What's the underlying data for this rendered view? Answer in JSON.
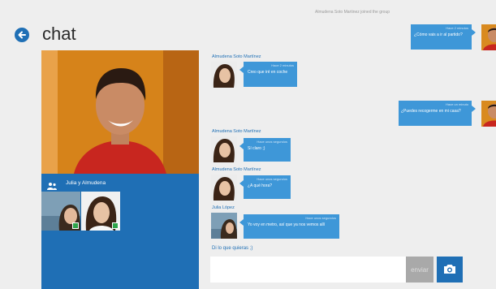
{
  "header": {
    "title": "chat",
    "system_note": "Almudena Soto Martinez joined the group"
  },
  "conversation": {
    "name": "Julia y Almudena"
  },
  "messages": [
    {
      "sender": "",
      "meta": "Hace 2 minutos",
      "text": "¿Cómo vais a ir al partido?"
    },
    {
      "sender": "Almudena Soto Martínez",
      "meta": "Hace 2 minutos",
      "text": "Creo que iré en coche"
    },
    {
      "sender": "",
      "meta": "Hace un minuto",
      "text": "¿Puedes recogerme en mi casa?"
    },
    {
      "sender": "Almudena Soto Martínez",
      "meta": "Hace unos segundos",
      "text": "Sí claro ;)"
    },
    {
      "sender": "Almudena Soto Martínez",
      "meta": "Hace unos segundos",
      "text": "¿A qué hora?"
    },
    {
      "sender": "Julia López",
      "meta": "Hace unos segundos",
      "text": "Yo voy en metro, así que ya nos vemos allí"
    }
  ],
  "compose": {
    "label": "Di lo que quieras ;)",
    "placeholder": "",
    "value": "",
    "send_label": "enviar"
  },
  "icons": {
    "back": "back-arrow-icon",
    "group": "group-icon",
    "camera": "camera-icon"
  },
  "colors": {
    "accent": "#1f6fb5",
    "bubble": "#3e97d8",
    "background": "#eeeeee",
    "status": "#2ea34a"
  }
}
